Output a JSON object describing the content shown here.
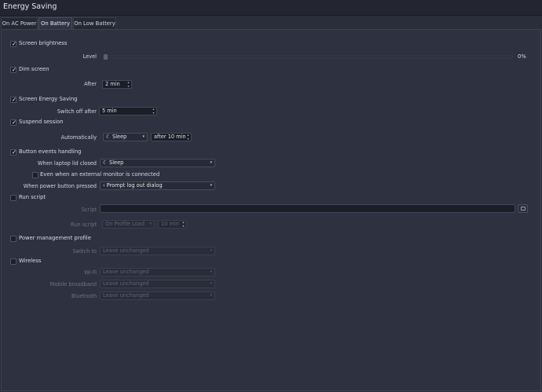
{
  "window": {
    "title": "Energy Saving"
  },
  "tabs": [
    {
      "label": "On AC Power"
    },
    {
      "label": "On Battery"
    },
    {
      "label": "On Low Battery"
    }
  ],
  "screen_brightness": {
    "label": "Screen brightness",
    "checked": true,
    "level_label": "Level",
    "value_text": "0%",
    "value": 0
  },
  "dim_screen": {
    "label": "Dim screen",
    "checked": true,
    "after_label": "After",
    "after_value": "2 min"
  },
  "screen_energy_saving": {
    "label": "Screen Energy Saving",
    "checked": true,
    "switch_off_label": "Switch off after",
    "switch_off_value": "5 min"
  },
  "suspend_session": {
    "label": "Suspend session",
    "checked": true,
    "automatically_label": "Automatically",
    "action": "Sleep",
    "after_value": "after 10 min"
  },
  "button_events": {
    "label": "Button events handling",
    "checked": true,
    "lid_label": "When laptop lid closed",
    "lid_action": "Sleep",
    "external_monitor_label": "Even when an external monitor is connected",
    "external_monitor_checked": false,
    "power_button_label": "When power button pressed",
    "power_button_action": "Prompt log out dialog"
  },
  "run_script": {
    "label": "Run script",
    "checked": false,
    "script_label": "Script",
    "script_value": "",
    "run_label": "Run script",
    "run_when": "On Profile Load",
    "run_after": "10 min"
  },
  "power_profile": {
    "label": "Power management profile",
    "checked": false,
    "switch_to_label": "Switch to",
    "switch_to_value": "Leave unchanged"
  },
  "wireless": {
    "label": "Wireless",
    "checked": false,
    "wifi_label": "Wi-Fi",
    "wifi_value": "Leave unchanged",
    "mobile_label": "Mobile broadband",
    "mobile_value": "Leave unchanged",
    "bluetooth_label": "Bluetooth",
    "bluetooth_value": "Leave unchanged"
  },
  "icons": {
    "check": "✓",
    "dropdown": "▾",
    "spin_up": "▴",
    "spin_down": "▾",
    "sleep": "moon-icon",
    "prompt": "chevron-left-icon",
    "folder": "folder-icon"
  },
  "colors": {
    "background": "#2d3140",
    "header": "#232631",
    "field": "#1b1e27"
  }
}
